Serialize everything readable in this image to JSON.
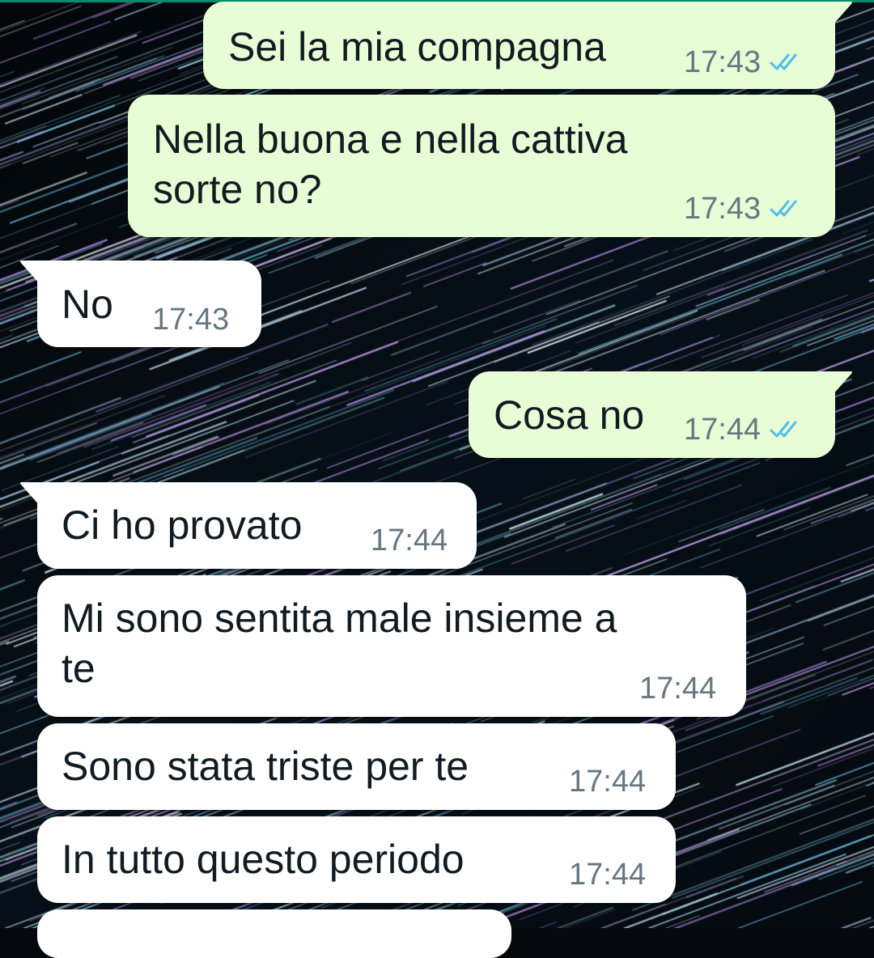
{
  "colors": {
    "outgoing_bubble": "#e7fdd6",
    "incoming_bubble": "#ffffff",
    "text": "#111b21",
    "timestamp": "#667781",
    "read_ticks": "#53bdeb",
    "wallpaper": "#05090d",
    "header_accent": "#0b8a6d"
  },
  "wallpaper": {
    "icon": "star-trails-wallpaper"
  },
  "messages": [
    {
      "direction": "outgoing",
      "text": "Sei la mia compagna",
      "time": "17:43",
      "status": "read"
    },
    {
      "direction": "outgoing",
      "text": "Nella buona e nella cattiva\nsorte no?",
      "time": "17:43",
      "status": "read"
    },
    {
      "direction": "incoming",
      "text": "No",
      "time": "17:43"
    },
    {
      "direction": "outgoing",
      "text": "Cosa no",
      "time": "17:44",
      "status": "read"
    },
    {
      "direction": "incoming",
      "text": "Ci ho provato",
      "time": "17:44"
    },
    {
      "direction": "incoming",
      "text": "Mi sono sentita male insieme a\nte",
      "time": "17:44"
    },
    {
      "direction": "incoming",
      "text": "Sono stata triste per te",
      "time": "17:44"
    },
    {
      "direction": "incoming",
      "text": "In tutto questo periodo",
      "time": "17:44"
    }
  ]
}
